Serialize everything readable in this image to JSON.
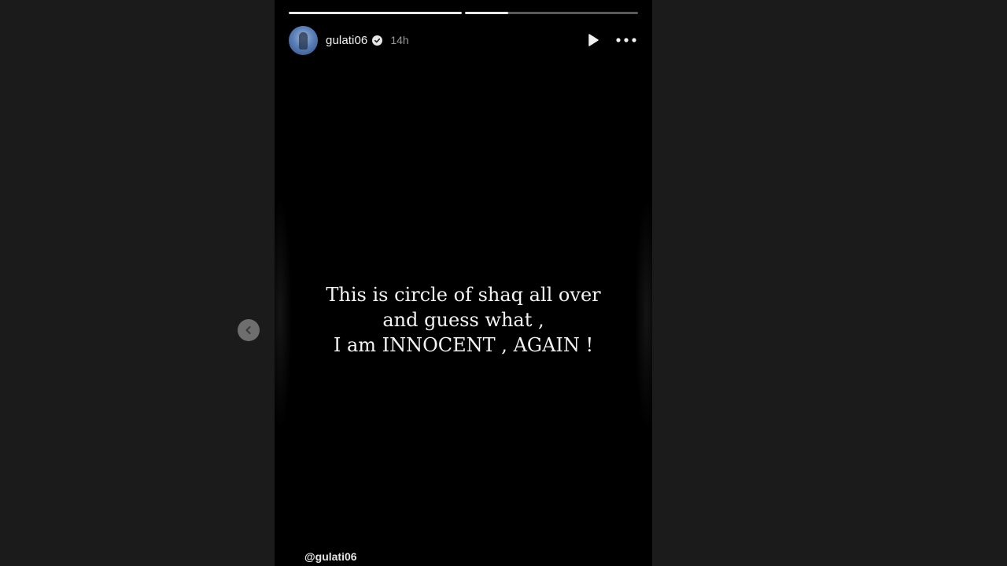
{
  "story": {
    "username": "gulati06",
    "time_ago": "14h",
    "progress": [
      {
        "segment": 1,
        "fill_percent": 100
      },
      {
        "segment": 2,
        "fill_percent": 25
      }
    ],
    "text_lines": [
      "This is circle of shaq all over",
      "and guess what ,",
      "I am INNOCENT , AGAIN !"
    ],
    "watermark_handle": "@gulati06"
  },
  "icons": {
    "avatar": "profile-avatar",
    "verified": "verified-badge-icon",
    "play": "play-icon",
    "more": "more-options-icon",
    "previous": "chevron-left-icon"
  },
  "colors": {
    "page_background": "#1b1b1c",
    "story_background": "#000000",
    "text": "#f4f4f4",
    "time": "#9a9a9a",
    "prev_button": "#6e6e6e"
  }
}
